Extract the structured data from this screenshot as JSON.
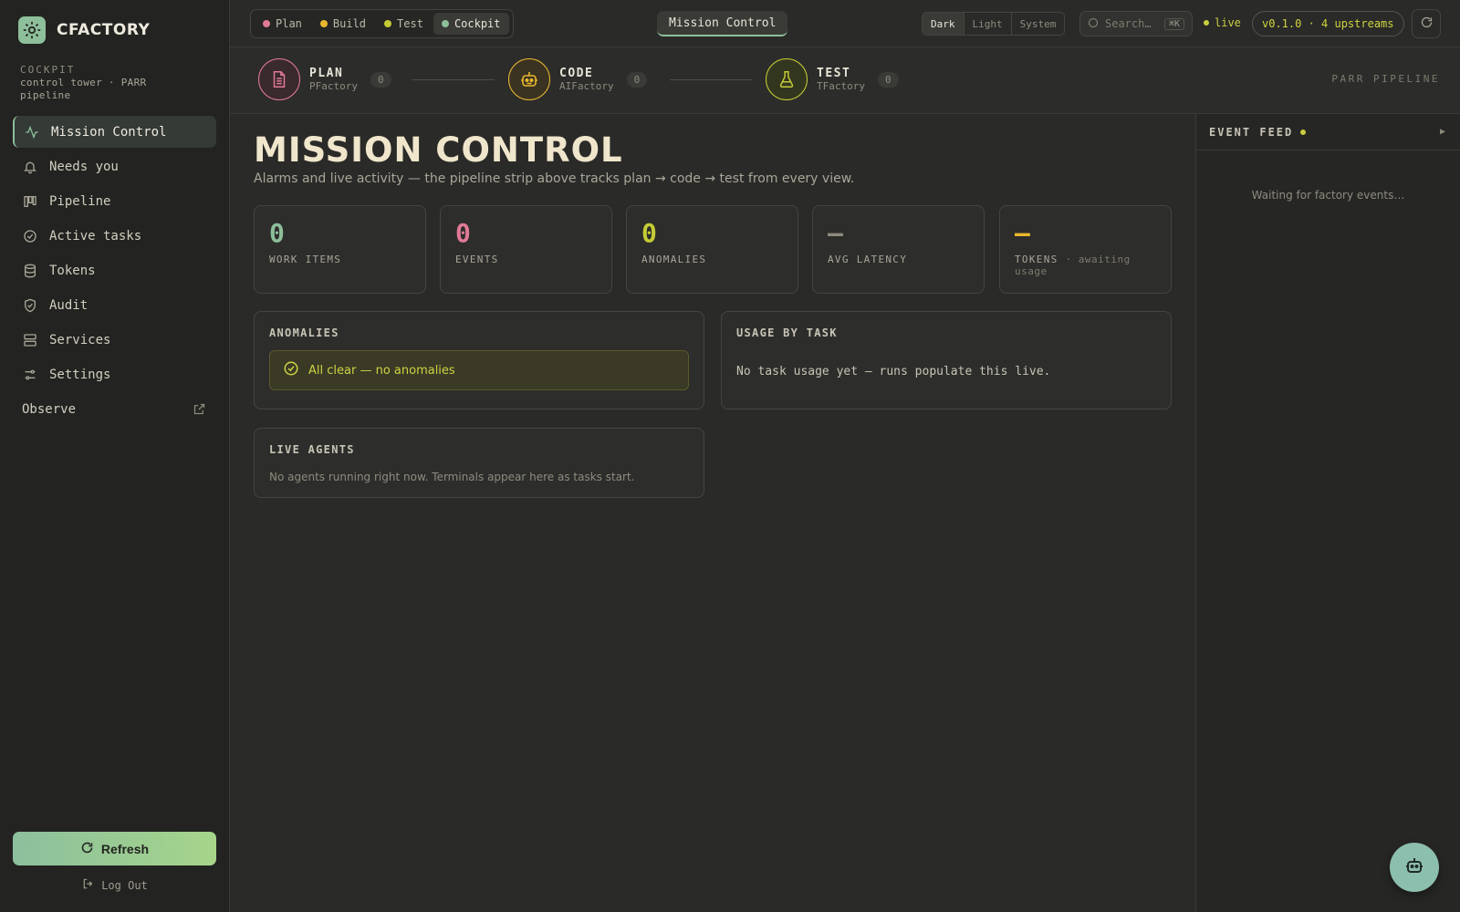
{
  "brand": {
    "name": "CFACTORY"
  },
  "sidebar": {
    "section_kicker": "COCKPIT",
    "section_desc": "control tower · PARR pipeline",
    "items": [
      {
        "label": "Mission Control",
        "icon": "activity-icon",
        "active": true
      },
      {
        "label": "Needs you",
        "icon": "bell-icon"
      },
      {
        "label": "Pipeline",
        "icon": "kanban-icon"
      },
      {
        "label": "Active tasks",
        "icon": "check-circle-icon"
      },
      {
        "label": "Tokens",
        "icon": "database-icon"
      },
      {
        "label": "Audit",
        "icon": "shield-check-icon"
      },
      {
        "label": "Services",
        "icon": "server-icon"
      },
      {
        "label": "Settings",
        "icon": "sliders-icon"
      }
    ],
    "observe_label": "Observe",
    "refresh_label": "Refresh",
    "logout_label": "Log Out"
  },
  "topbar": {
    "view_tabs": [
      {
        "label": "Plan",
        "color": "#e07a95"
      },
      {
        "label": "Build",
        "color": "#e8b82e"
      },
      {
        "label": "Test",
        "color": "#c5cc34"
      },
      {
        "label": "Cockpit",
        "color": "#8dbf9a",
        "active": true
      }
    ],
    "breadcrumb": "Mission Control",
    "theme_options": [
      "Dark",
      "Light",
      "System"
    ],
    "theme_selected": "Dark",
    "search_placeholder": "Search…",
    "search_shortcut": "⌘K",
    "live_label": "live",
    "version": "v0.1.0 · 4 upstreams"
  },
  "pipeline": {
    "stages": [
      {
        "name": "PLAN",
        "sub": "PFactory",
        "count": "0",
        "color": "#e07a95"
      },
      {
        "name": "CODE",
        "sub": "AIFactory",
        "count": "0",
        "color": "#e8b82e"
      },
      {
        "name": "TEST",
        "sub": "TFactory",
        "count": "0",
        "color": "#c5cc34"
      }
    ],
    "label": "PARR PIPELINE"
  },
  "main": {
    "title": "MISSION CONTROL",
    "subtitle": "Alarms and live activity — the pipeline strip above tracks plan → code → test from every view.",
    "stats": [
      {
        "value": "0",
        "label": "WORK ITEMS",
        "color": "#8dbf9a"
      },
      {
        "value": "0",
        "label": "EVENTS",
        "color": "#e07a95"
      },
      {
        "value": "0",
        "label": "ANOMALIES",
        "color": "#c5cc34"
      },
      {
        "value": "—",
        "label": "AVG LATENCY",
        "color": "#8e8b7e"
      },
      {
        "value": "—",
        "label": "TOKENS",
        "label_extra": "· awaiting usage",
        "color": "#e8b82e"
      }
    ],
    "anomalies": {
      "title": "ANOMALIES",
      "message": "All clear — no anomalies"
    },
    "usage": {
      "title": "USAGE BY TASK",
      "message": "No task usage yet — runs populate this live."
    },
    "agents": {
      "title": "LIVE AGENTS",
      "message": "No agents running right now. Terminals appear here as tasks start."
    }
  },
  "feed": {
    "title": "EVENT FEED",
    "toggle": "▶",
    "empty": "Waiting for factory events…"
  }
}
